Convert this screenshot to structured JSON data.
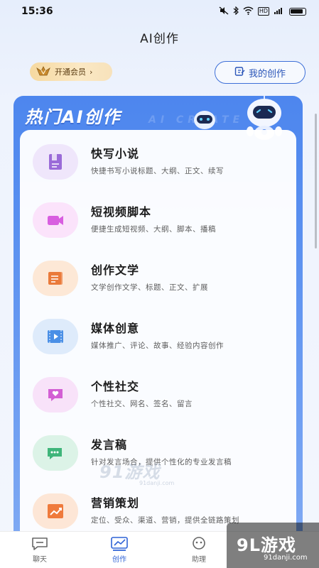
{
  "status_bar": {
    "time": "15:36",
    "signal": "5G",
    "hd": "HD"
  },
  "header": {
    "title": "AI创作"
  },
  "vip": {
    "label": "开通会员",
    "chevron": "›"
  },
  "my_creations": {
    "label": "我的创作",
    "icon": "edit-icon"
  },
  "hot_section": {
    "title": "热门AI创作",
    "ghost_text": "AI CREATE"
  },
  "items": [
    {
      "title": "快写小说",
      "desc": "快捷书写小说标题、大纲、正文、续写",
      "icon": "book-icon",
      "color": "#9a6bd8",
      "bg": "#efe6fb"
    },
    {
      "title": "短视频脚本",
      "desc": "便捷生成短视频、大纲、脚本、播稿",
      "icon": "video-camera-icon",
      "color": "#d85ee0",
      "bg": "#fbe3fb"
    },
    {
      "title": "创作文学",
      "desc": "文学创作文学、标题、正文、扩展",
      "icon": "scroll-icon",
      "color": "#ea7a3a",
      "bg": "#fde8d6"
    },
    {
      "title": "媒体创意",
      "desc": "媒体推广、评论、故事、经验内容创作",
      "icon": "film-icon",
      "color": "#4a8fe6",
      "bg": "#deebfb"
    },
    {
      "title": "个性社交",
      "desc": "个性社交、网名、签名、留言",
      "icon": "heart-chat-icon",
      "color": "#d35fd4",
      "bg": "#f8e2f9"
    },
    {
      "title": "发言稿",
      "desc": "针对发言场合，提供个性化的专业发言稿",
      "icon": "chat-bubble-icon",
      "color": "#3fb57a",
      "bg": "#dcf3e7"
    },
    {
      "title": "营销策划",
      "desc": "定位、受众、渠道、营销，提供全链路策划",
      "icon": "trend-chart-icon",
      "color": "#ef7a3c",
      "bg": "#fde6d6"
    }
  ],
  "bottom_nav": [
    {
      "label": "聊天",
      "icon": "chat-icon",
      "active": false
    },
    {
      "label": "创作",
      "icon": "chart-icon",
      "active": true
    },
    {
      "label": "助理",
      "icon": "assistant-icon",
      "active": false
    }
  ],
  "watermark": {
    "center": "91游戏",
    "center_sub": "91danji.com",
    "corner": "9L游戏",
    "corner_sub": "91danji.com"
  },
  "colors": {
    "accent": "#2f63d6",
    "panel": "#4d86ee"
  }
}
